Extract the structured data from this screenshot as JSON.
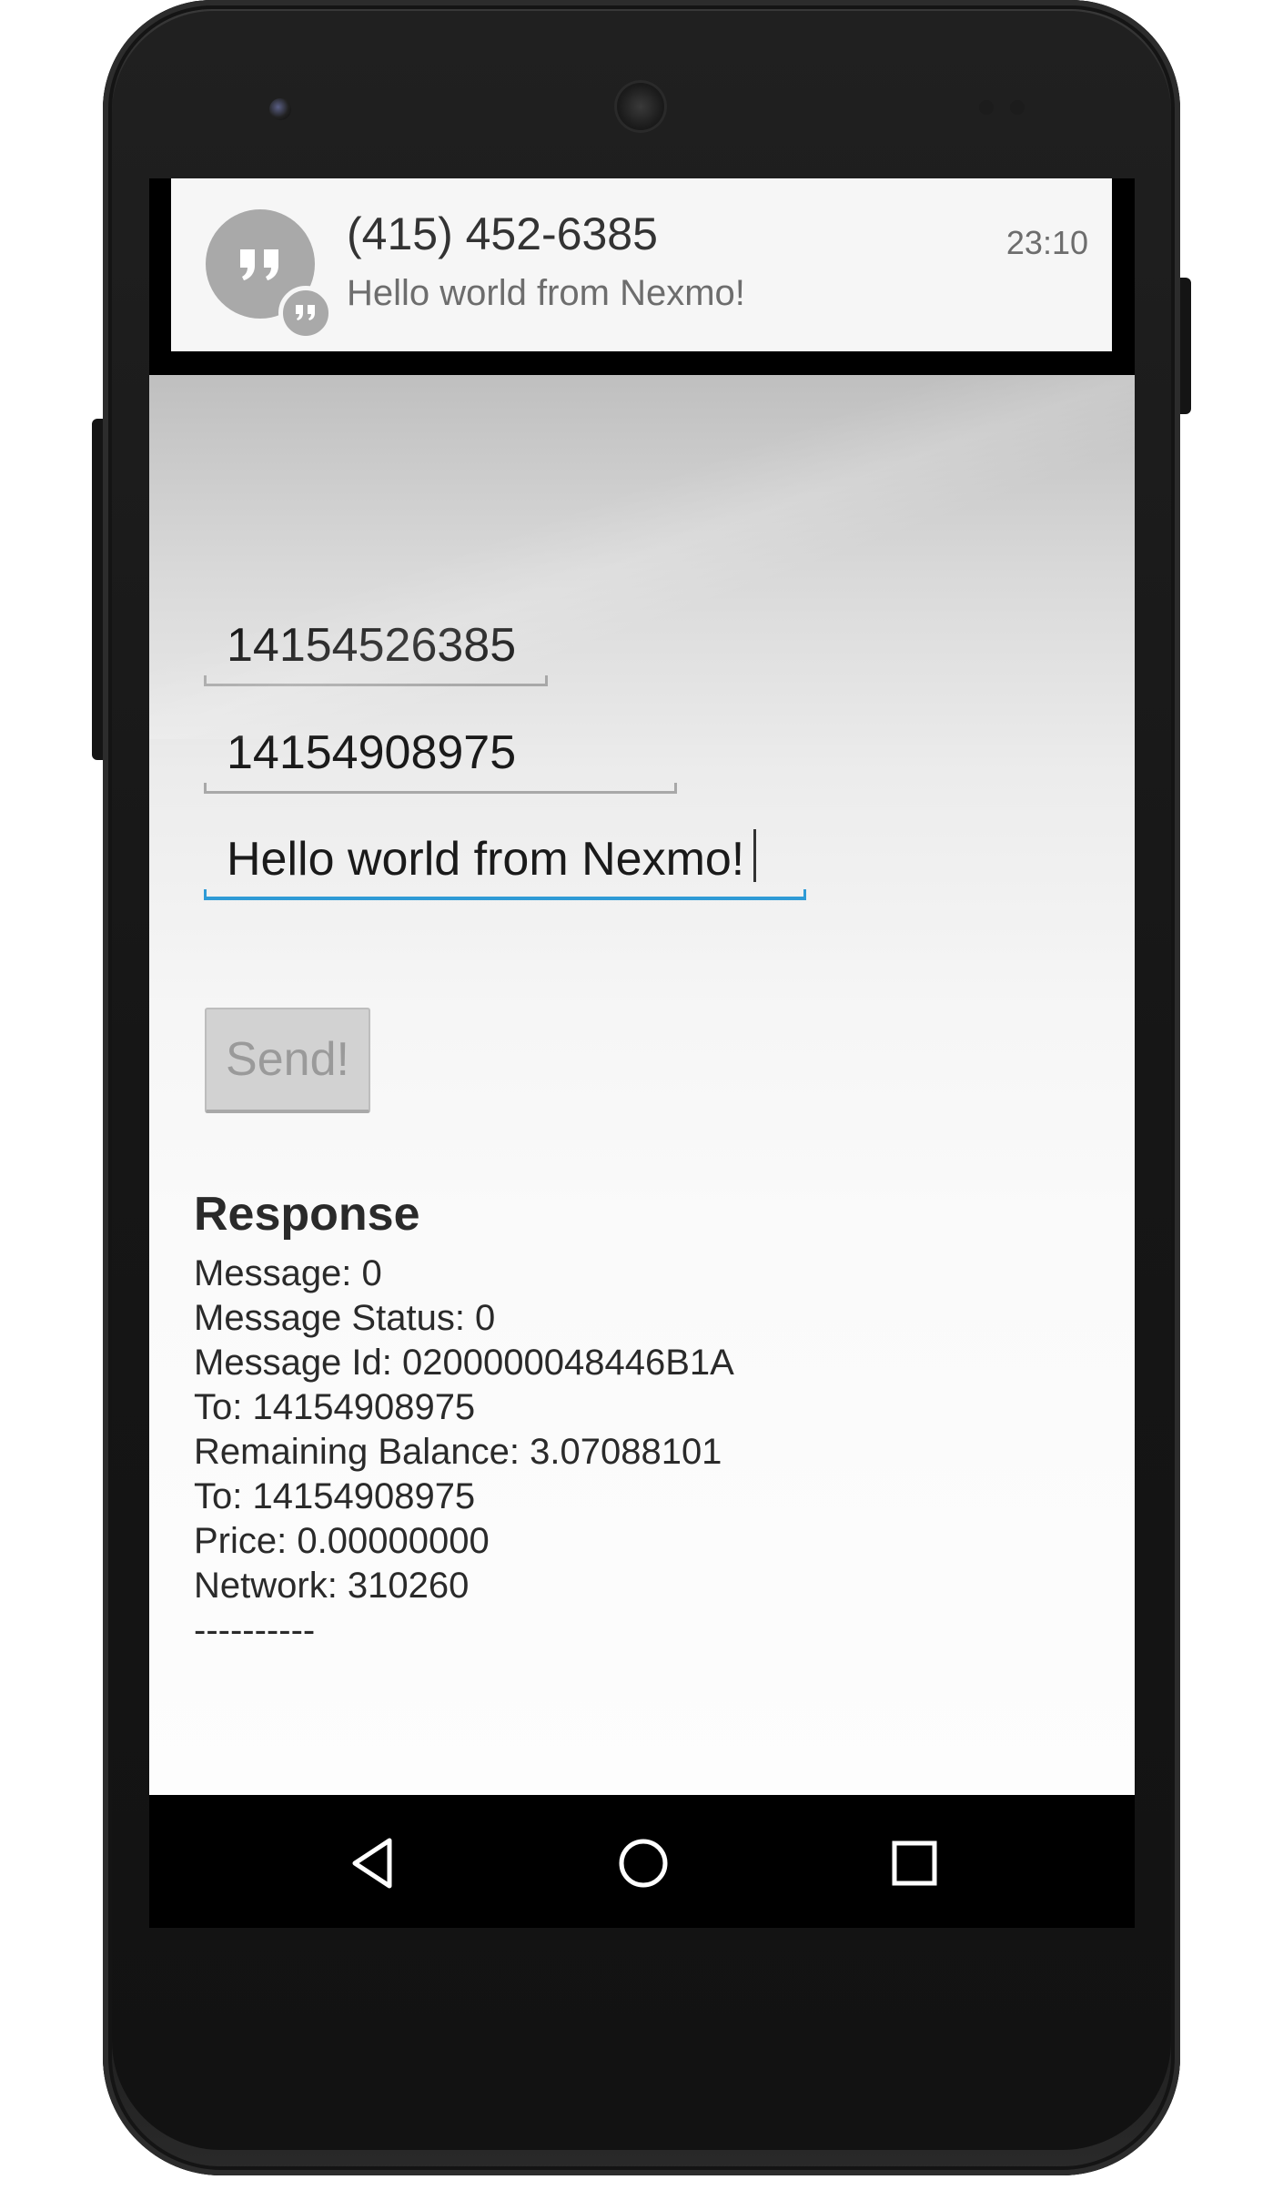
{
  "notification": {
    "title": "(415) 452-6385",
    "text": "Hello world from Nexmo!",
    "time": "23:10",
    "app_icon": "hangouts-icon"
  },
  "form": {
    "from_value": "14154526385",
    "to_value": "14154908975",
    "message_value": "Hello world from Nexmo!",
    "send_label": "Send!"
  },
  "response": {
    "title": "Response",
    "lines": [
      "Message: 0",
      "Message Status: 0",
      "Message Id: 0200000048446B1A",
      "To: 14154908975",
      "Remaining Balance: 3.07088101",
      "To: 14154908975",
      "Price: 0.00000000",
      "Network: 310260",
      "----------"
    ]
  },
  "navigation": {
    "back_icon": "back-icon",
    "home_icon": "home-icon",
    "recents_icon": "recents-icon"
  },
  "colors": {
    "accent": "#2f9bd6",
    "notification_bg": "#f6f6f6",
    "button_bg": "#d2d2d2"
  }
}
